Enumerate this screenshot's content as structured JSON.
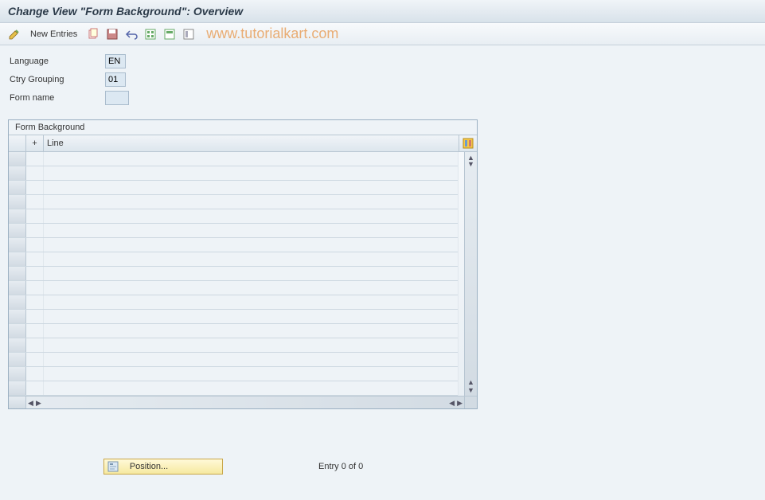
{
  "title": "Change View \"Form Background\": Overview",
  "toolbar": {
    "new_entries_label": "New Entries"
  },
  "watermark": "www.tutorialkart.com",
  "fields": {
    "language": {
      "label": "Language",
      "value": "EN"
    },
    "ctry_grouping": {
      "label": "Ctry Grouping",
      "value": "01"
    },
    "form_name": {
      "label": "Form name",
      "value": ""
    }
  },
  "table": {
    "caption": "Form Background",
    "columns": {
      "plus": "+",
      "line": "Line"
    },
    "rows": [
      "",
      "",
      "",
      "",
      "",
      "",
      "",
      "",
      "",
      "",
      "",
      "",
      "",
      "",
      "",
      "",
      ""
    ]
  },
  "footer": {
    "position_label": "Position...",
    "entry_text": "Entry 0 of 0"
  }
}
